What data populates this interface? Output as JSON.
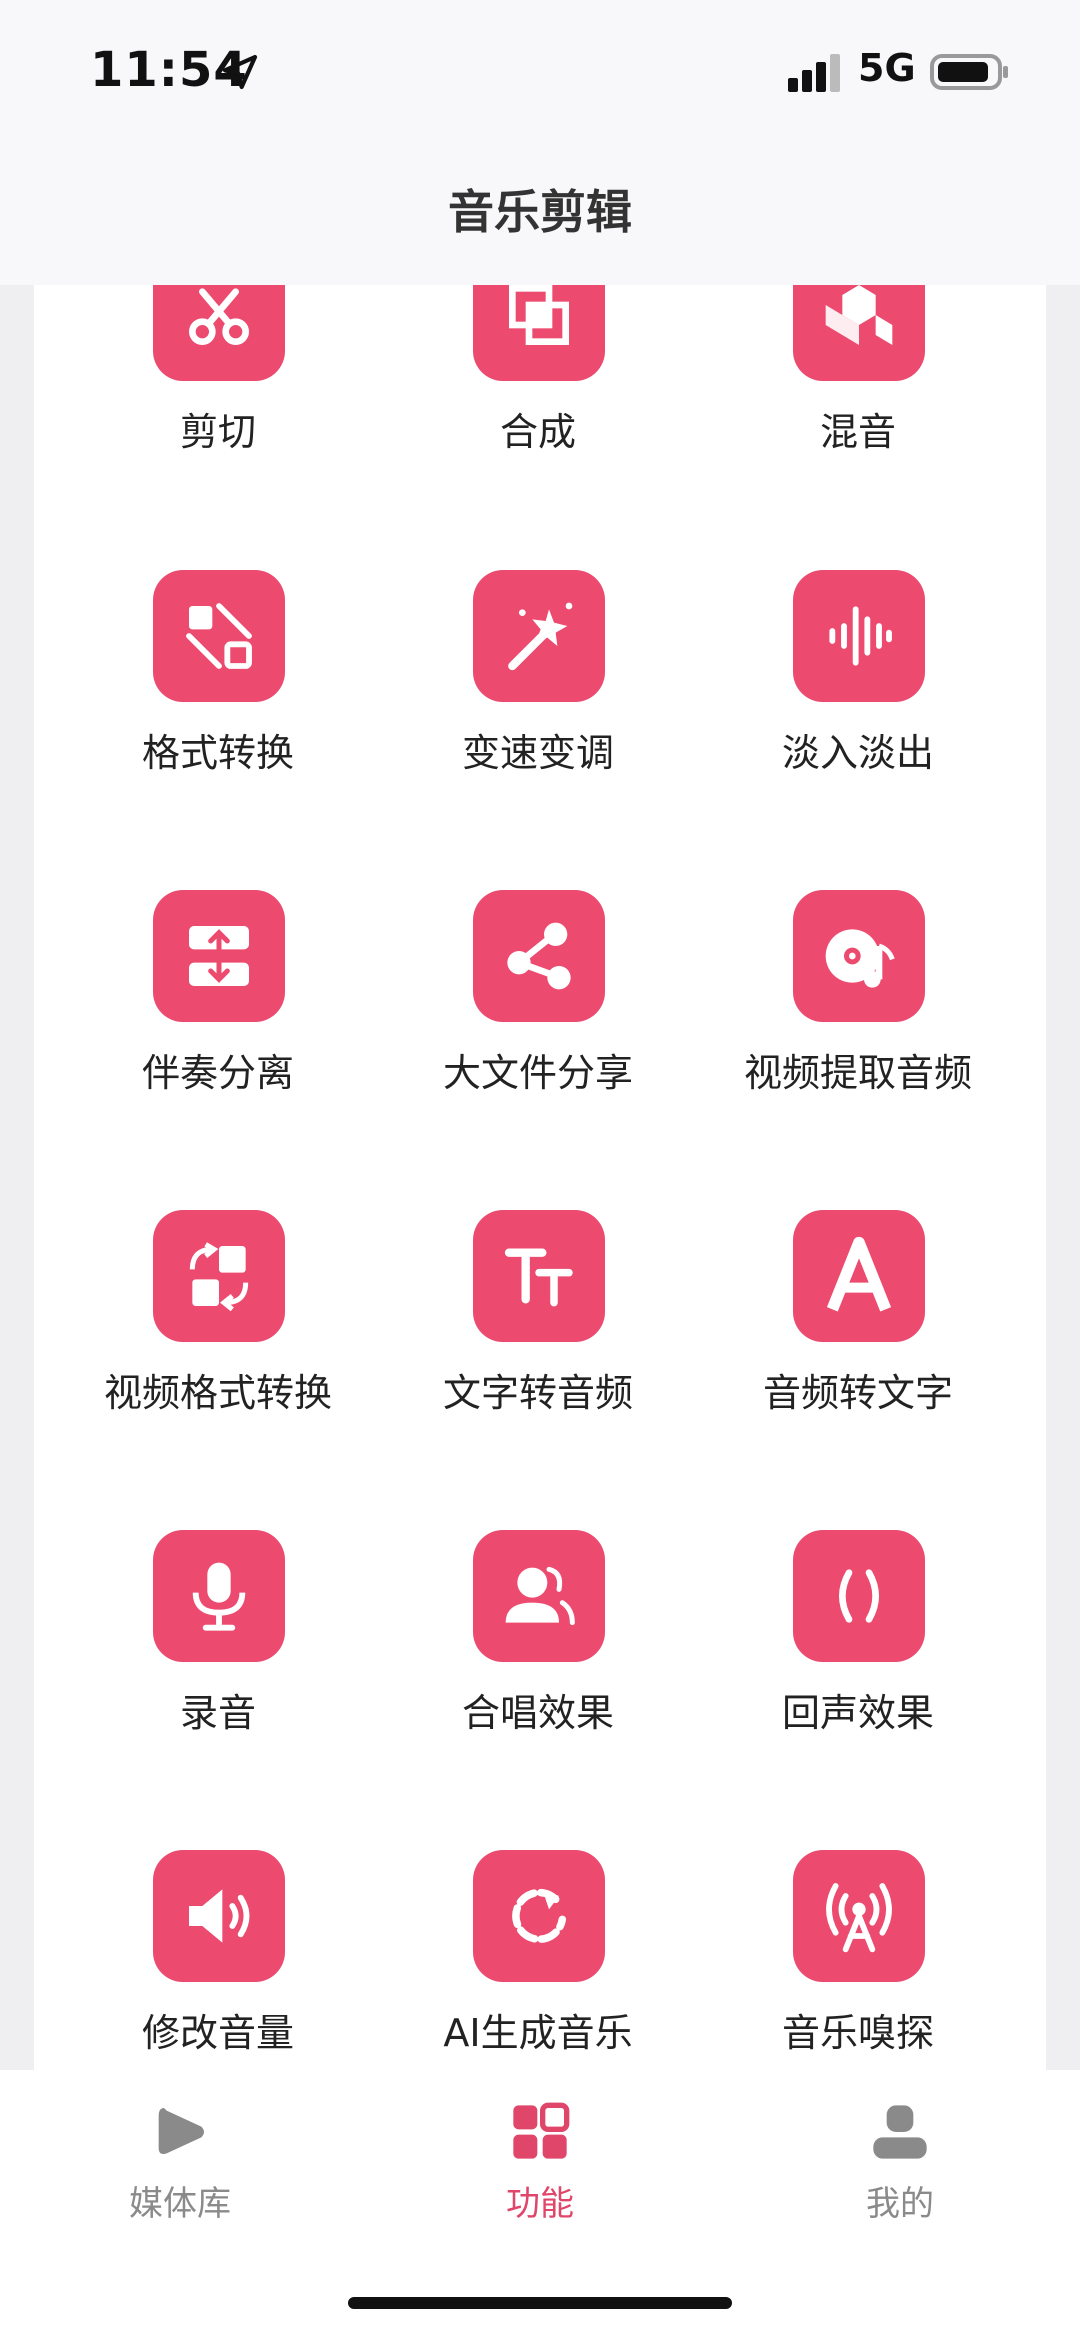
{
  "status_bar": {
    "time": "11:54",
    "network": "5G"
  },
  "header": {
    "title": "音乐剪辑"
  },
  "features": [
    {
      "label": "剪切",
      "icon": "scissors-icon"
    },
    {
      "label": "合成",
      "icon": "merge-squares-icon"
    },
    {
      "label": "混音",
      "icon": "cubes-icon"
    },
    {
      "label": "格式转换",
      "icon": "shape-convert-icon"
    },
    {
      "label": "变速变调",
      "icon": "magic-wand-icon"
    },
    {
      "label": "淡入淡出",
      "icon": "waveform-icon"
    },
    {
      "label": "伴奏分离",
      "icon": "split-icon"
    },
    {
      "label": "大文件分享",
      "icon": "share-icon"
    },
    {
      "label": "视频提取音频",
      "icon": "disc-note-icon"
    },
    {
      "label": "视频格式转换",
      "icon": "format-swap-icon"
    },
    {
      "label": "文字转音频",
      "icon": "text-size-icon"
    },
    {
      "label": "音频转文字",
      "icon": "letter-a-icon"
    },
    {
      "label": "录音",
      "icon": "microphone-icon"
    },
    {
      "label": "合唱效果",
      "icon": "users-icon"
    },
    {
      "label": "回声效果",
      "icon": "parentheses-icon"
    },
    {
      "label": "修改音量",
      "icon": "speaker-icon"
    },
    {
      "label": "AI生成音乐",
      "icon": "refresh-icon"
    },
    {
      "label": "音乐嗅探",
      "icon": "broadcast-icon"
    }
  ],
  "tabs": [
    {
      "label": "媒体库",
      "icon": "play-icon",
      "active": false
    },
    {
      "label": "功能",
      "icon": "grid-icon",
      "active": true
    },
    {
      "label": "我的",
      "icon": "person-icon",
      "active": false
    }
  ],
  "colors": {
    "accent": "#ec4a6e",
    "active_tab": "#e0456a",
    "inactive_tab": "#8a8a8a"
  }
}
